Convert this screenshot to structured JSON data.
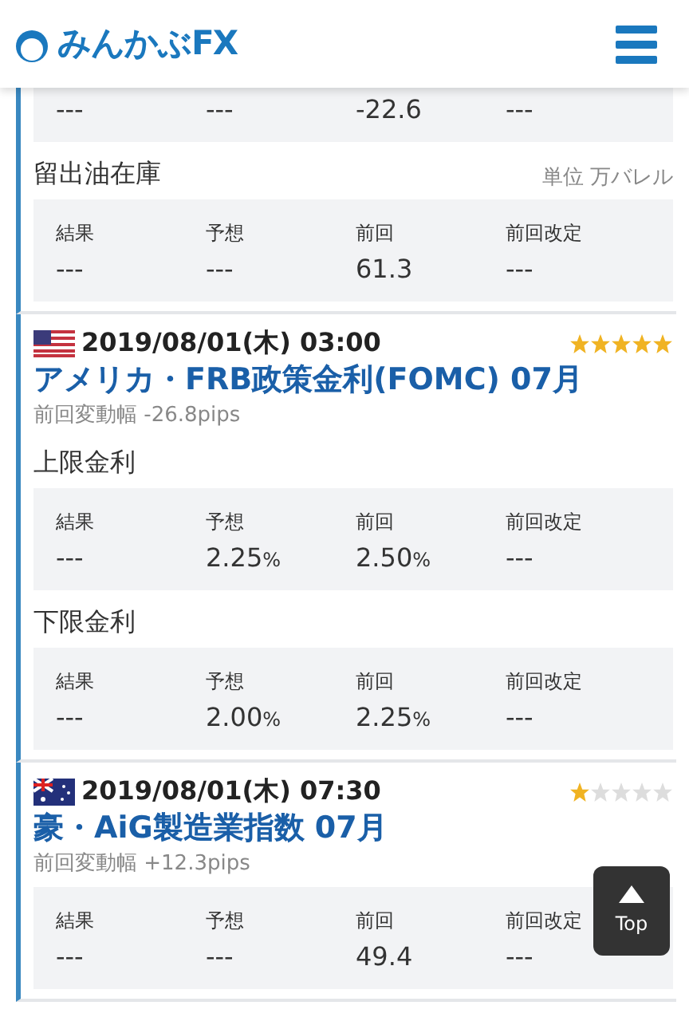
{
  "header": {
    "logo": "みんかぶFX"
  },
  "events": [
    {
      "kind": "continued",
      "sections": [
        {
          "values": [
            {
              "value": "---"
            },
            {
              "value": "---"
            },
            {
              "value": "-22.6"
            },
            {
              "value": "---"
            }
          ]
        },
        {
          "title": "留出油在庫",
          "unit": "単位 万バレル",
          "labels": [
            "結果",
            "予想",
            "前回",
            "前回改定"
          ],
          "values": [
            {
              "value": "---"
            },
            {
              "value": "---"
            },
            {
              "value": "61.3"
            },
            {
              "value": "---"
            }
          ]
        }
      ]
    },
    {
      "kind": "event",
      "flag": {
        "kind": "us"
      },
      "datetime": "2019/08/01(木) 03:00",
      "stars": 5,
      "title": "アメリカ・FRB政策金利(FOMC) 07月",
      "change_label": "前回変動幅",
      "change": "-26.8pips",
      "sections": [
        {
          "title": "上限金利",
          "labels": [
            "結果",
            "予想",
            "前回",
            "前回改定"
          ],
          "values": [
            {
              "value": "---"
            },
            {
              "value": "2.25",
              "unit": "%"
            },
            {
              "value": "2.50",
              "unit": "%"
            },
            {
              "value": "---"
            }
          ]
        },
        {
          "title": "下限金利",
          "labels": [
            "結果",
            "予想",
            "前回",
            "前回改定"
          ],
          "values": [
            {
              "value": "---"
            },
            {
              "value": "2.00",
              "unit": "%"
            },
            {
              "value": "2.25",
              "unit": "%"
            },
            {
              "value": "---"
            }
          ]
        }
      ]
    },
    {
      "kind": "event",
      "flag": {
        "kind": "au"
      },
      "datetime": "2019/08/01(木) 07:30",
      "stars": 1,
      "title": "豪・AiG製造業指数 07月",
      "change_label": "前回変動幅",
      "change": "+12.3pips",
      "sections": [
        {
          "labels": [
            "結果",
            "予想",
            "前回",
            "前回改定"
          ],
          "values": [
            {
              "value": "---"
            },
            {
              "value": "---"
            },
            {
              "value": "49.4"
            },
            {
              "value": "---"
            }
          ]
        }
      ]
    }
  ],
  "top_button": {
    "label": "Top"
  }
}
